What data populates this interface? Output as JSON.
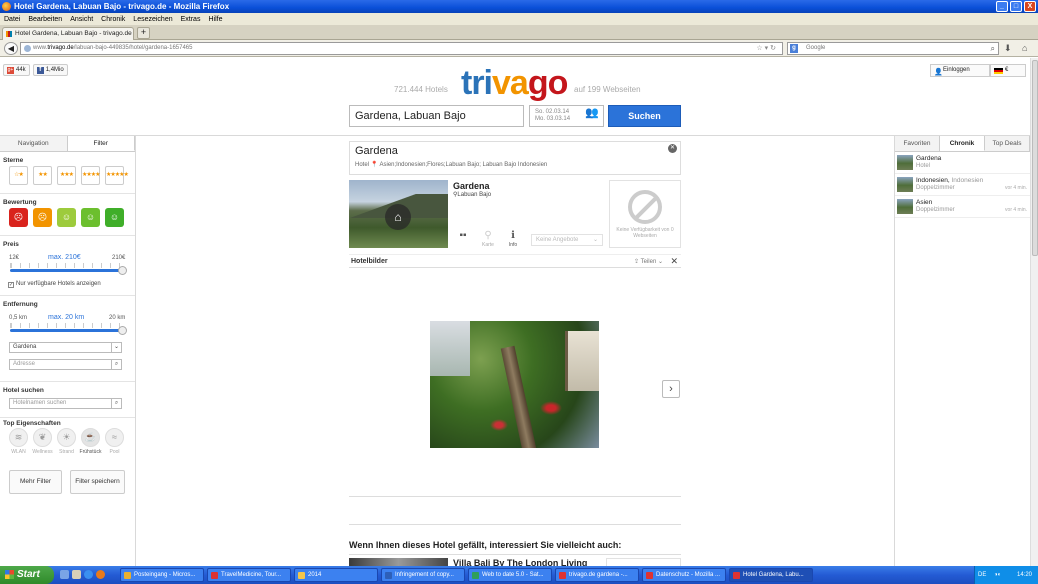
{
  "window": {
    "title": "Hotel Gardena, Labuan Bajo - trivago.de - Mozilla Firefox",
    "buttons": {
      "minimize": "_",
      "maximize": "□",
      "close": "X"
    }
  },
  "menu": [
    "Datei",
    "Bearbeiten",
    "Ansicht",
    "Chronik",
    "Lesezeichen",
    "Extras",
    "Hilfe"
  ],
  "browser": {
    "tab_title": "Hotel Gardena, Labuan Bajo - trivago.de",
    "newtab": "+",
    "url_prefix": "www.",
    "url_domain": "trivago.de",
    "url_path": "/labuan-bajo-449835/hotel/gardena-1657465",
    "search_engine": "Google",
    "search_placeholder": "Google"
  },
  "header": {
    "gplus_count": "44k",
    "fb_count": "1,4Mio",
    "hotel_count": "721.444 Hotels",
    "logo": [
      "tri",
      "va",
      "go"
    ],
    "web_count": "auf 199 Webseiten",
    "login": "Einloggen",
    "lang": "€",
    "search_value": "Gardena, Labuan Bajo",
    "checkin": "So.   02.03.14",
    "checkout": "Mo.   03.03.14",
    "search_button": "Suchen"
  },
  "left": {
    "tabs": [
      "Navigation",
      "Filter"
    ],
    "stars_title": "Sterne",
    "stars": [
      "☆★",
      "★★",
      "★★★",
      "★★★★",
      "★★★★★"
    ],
    "rating_title": "Bewertung",
    "faces": [
      "☹",
      "☹",
      "☺",
      "☺",
      "☺"
    ],
    "price_title": "Preis",
    "price_min": "12€",
    "price_mid": "max. 210€",
    "price_max": "210€",
    "only_available": "Nur verfügbare Hotels anzeigen",
    "distance_title": "Entfernung",
    "dist_min": "0,5 km",
    "dist_mid": "max. 20 km",
    "dist_max": "20 km",
    "location_select": "Gardena",
    "address_placeholder": "Adresse",
    "hotel_search_title": "Hotel suchen",
    "hotel_search_placeholder": "Hotelnamen suchen",
    "features_title": "Top Eigenschaften",
    "features": [
      {
        "label": "WLAN",
        "icon": "wifi-icon"
      },
      {
        "label": "Wellness",
        "icon": "wellness-icon"
      },
      {
        "label": "Strand",
        "icon": "beach-icon"
      },
      {
        "label": "Frühstück",
        "icon": "breakfast-icon"
      },
      {
        "label": "Pool",
        "icon": "pool-icon"
      }
    ],
    "more_filters": "Mehr Filter",
    "save_filters": "Filter speichern"
  },
  "hotel": {
    "name": "Gardena",
    "breadcrumb": "Hotel  📍 Asien;Indonesien;Flores;Labuan Bajo; Labuan Bajo Indonesien",
    "title": "Gardena",
    "location": "Labuan Bajo",
    "icon_labels": [
      "",
      "Karte",
      "Info"
    ],
    "offers_select": "Keine Angebote",
    "no_avail": "Keine Verfügbarkeit von 0 Webseiten",
    "gallery_title": "Hotelbilder",
    "share": "Teilen",
    "also_like": "Wenn Ihnen dieses Hotel gefällt, interessiert Sie vielleicht auch:",
    "next_hotel": "Villa Bali By The London Living"
  },
  "right": {
    "tabs": [
      "Favoriten",
      "Chronik",
      "Top Deals"
    ],
    "history": [
      {
        "name": "Gardena",
        "sub": "",
        "subline": "Hotel",
        "ago": ""
      },
      {
        "name": "Indonesien",
        "sub": "Indonesien",
        "subline": "Doppelzimmer",
        "ago": "vor 4 min."
      },
      {
        "name": "Asien",
        "sub": "",
        "subline": "Doppelzimmer",
        "ago": "vor 4 min."
      }
    ]
  },
  "taskbar": {
    "start": "Start",
    "tasks": [
      "Posteingang - Micros...",
      "TravelMedicine, Tour...",
      "2014",
      "Infringement of copy...",
      "Web to date 5.0 - Sat...",
      "trivago.de gardena -...",
      "Datenschutz - Mozilla ...",
      "Hotel Gardena, Labu..."
    ],
    "lang": "DE",
    "time": "14:20"
  }
}
